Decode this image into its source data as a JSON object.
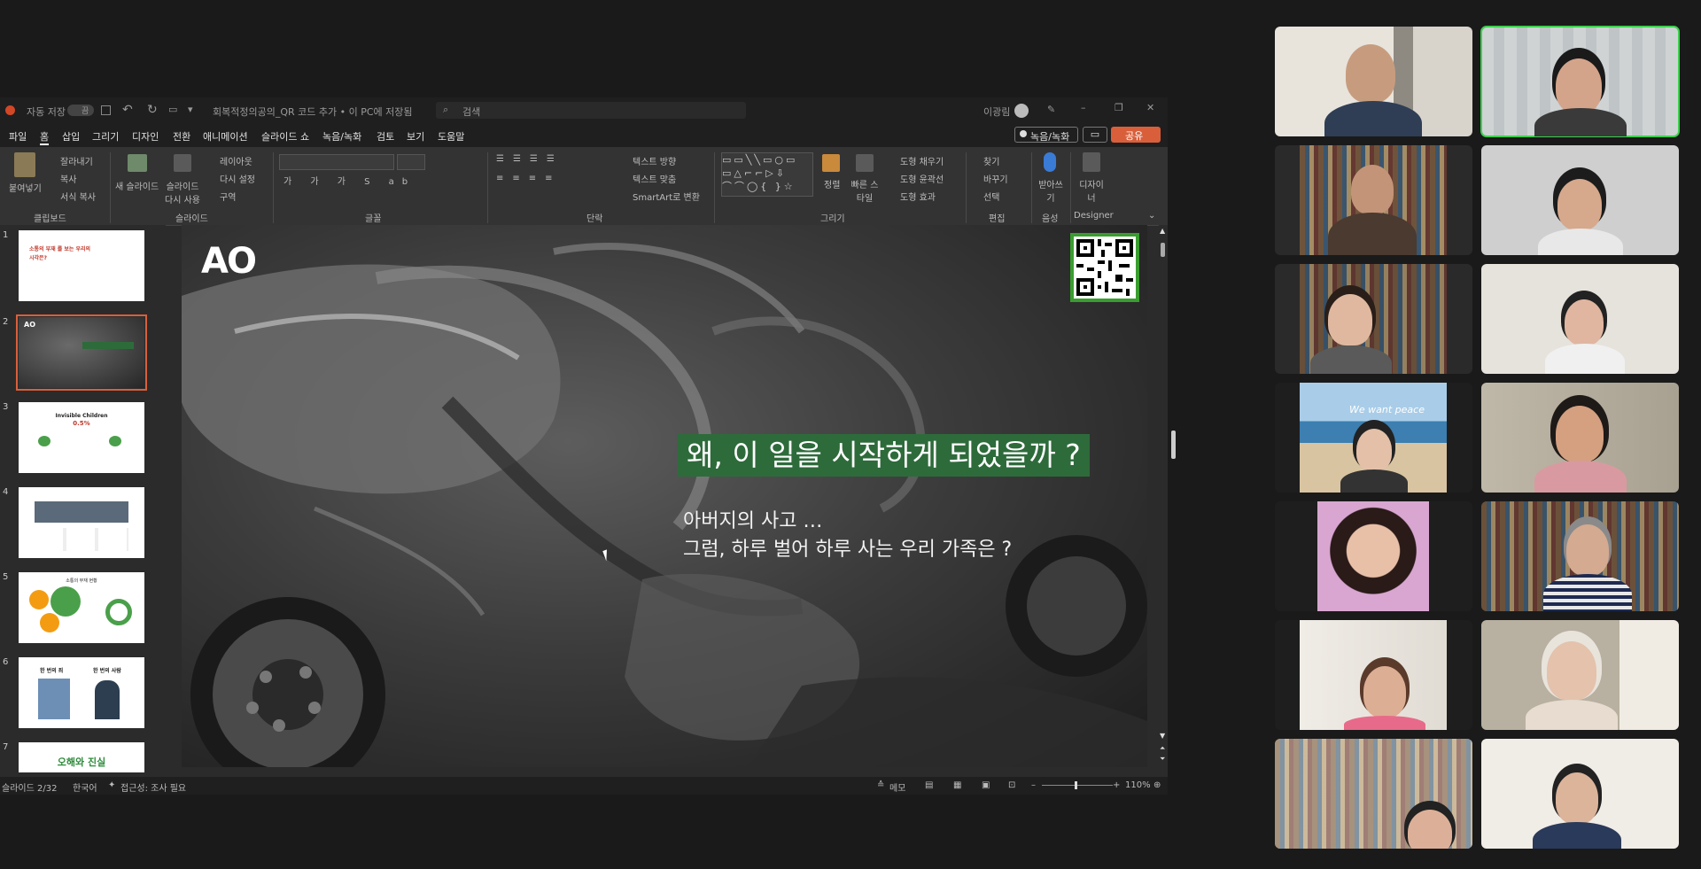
{
  "ppt": {
    "title_bar": {
      "autosave_label": "자동 저장",
      "autosave_state": "끔",
      "document_title": "회복적정의공의_QR 코드 추가 • 이 PC에 저장됨",
      "search_placeholder": "검색",
      "user_name": "이광림"
    },
    "menu": [
      "파일",
      "홈",
      "삽입",
      "그리기",
      "디자인",
      "전환",
      "애니메이션",
      "슬라이드 쇼",
      "녹음/녹화",
      "검토",
      "보기",
      "도움말"
    ],
    "record_button": "녹음/녹화",
    "share_button": "공유",
    "ribbon": {
      "clipboard": {
        "paste": "붙여넣기",
        "cut": "잘라내기",
        "copy": "복사",
        "format": "서식 복사",
        "group": "클립보드"
      },
      "slides": {
        "new_slide": "새 슬라이드",
        "reuse": "슬라이드 다시 사용",
        "layout": "레이아웃",
        "reset": "다시 설정",
        "section": "구역",
        "group": "슬라이드"
      },
      "font_group": "글꼴",
      "paragraph": {
        "direction": "텍스트 방향",
        "align": "텍스트 맞춤",
        "smartart": "SmartArt로 변환",
        "group": "단락"
      },
      "drawing": {
        "arrange": "정렬",
        "quick_styles": "빠른 스타일",
        "fill": "도형 채우기",
        "outline": "도형 윤곽선",
        "effects": "도형 효과",
        "group": "그리기"
      },
      "editing": {
        "find": "찾기",
        "replace": "바꾸기",
        "select": "선택",
        "group": "편집"
      },
      "voice": {
        "dictate": "받아쓰기",
        "group": "음성"
      },
      "designer": {
        "label": "디자이너",
        "group": "Designer"
      }
    },
    "thumbnails": {
      "numbers": [
        "1",
        "2",
        "3",
        "4",
        "5",
        "6",
        "7"
      ],
      "t1_line1": "소통의 부재 를 보는 우리의",
      "t1_line2": "시각은?",
      "t3_title": "Invisible Children",
      "t3_value": "0.5%",
      "t5_title": "소통의 부재 현황",
      "t6_left": "한 번의 죄",
      "t6_right": "한 번의 사람",
      "t7_title": "오해와 진실"
    },
    "slide": {
      "logo": "AO",
      "headline": "왜, 이 일을 시작하게 되었을까 ?",
      "line1": "아버지의 사고 …",
      "line2": "그럼, 하루 벌어 하루 사는 우리 가족은 ?"
    },
    "status": {
      "slide_counter": "슬라이드 2/32",
      "language": "한국어",
      "accessibility": "접근성: 조사 필요",
      "notes": "메모",
      "zoom": "110%"
    }
  },
  "video_banner_text": "We want peace",
  "colors": {
    "accent_green": "#2e6b3b",
    "active_speaker": "#3ccf4e",
    "share_orange": "#d95f3b"
  }
}
